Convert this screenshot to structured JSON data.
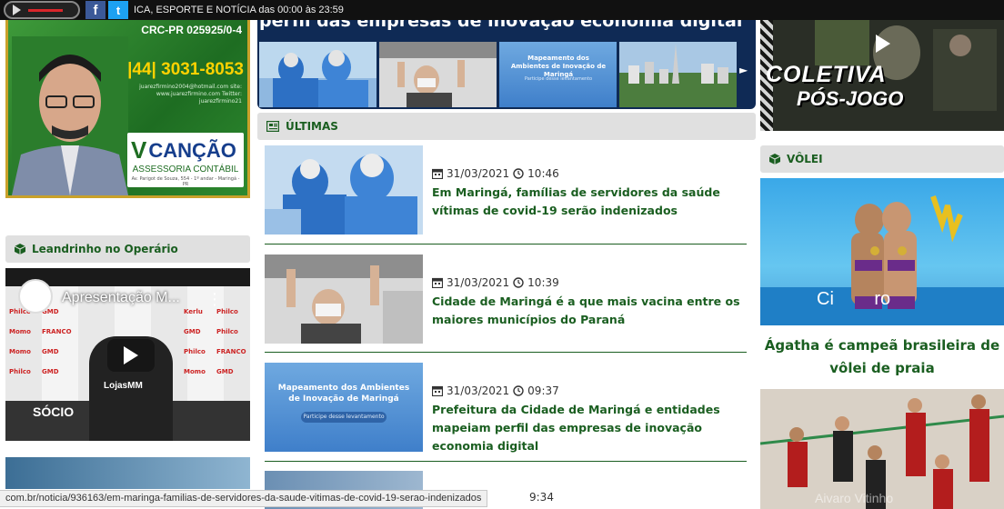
{
  "topbar": {
    "ticker": "ICA, ESPORTE E NOTÍCIA das 00:00 às 23:59",
    "fb": "f",
    "tw": "t"
  },
  "ad": {
    "crc": "CRC-PR 025925/0-4",
    "phone": "|44| 3031-8053",
    "small": "juarezfirmino2004@hotmail.com site: www.juarezfirmino.com Twitter: juarezfirmino21",
    "logo_v": "V",
    "logo_name": "CANÇÃO",
    "logo_sub": "ASSESSORIA CONTÁBIL",
    "logo_addr": "Av. Parigot de Souza, 554 - 1º andar - Maringá - PR"
  },
  "sections": {
    "ultimas": "ÚLTIMAS",
    "leandrinho": "Leandrinho no Operário",
    "volei": "VÔLEI"
  },
  "left_video": {
    "title": "Apresentação M...",
    "wall_brands": [
      "Philco",
      "GMD",
      "Kerlu",
      "Philco",
      "Momo",
      "FRANCO",
      "GMD",
      "Philco",
      "Momo",
      "GMD",
      "Philco",
      "FRANCO",
      "Philco",
      "GMD",
      "Momo",
      "GMD"
    ],
    "socio": "SÓCIO",
    "sponsor": "LojasMM"
  },
  "banner": {
    "headline": "perfil das empresas de inovação economia digital",
    "thumb3_title": "Mapeamento dos Ambientes de Inovação de Maringá",
    "thumb3_sub": "Participe desse levantamento"
  },
  "news": [
    {
      "date": "31/03/2021",
      "time": "10:46",
      "headline": "Em Maringá, famílias de servidores da saúde vítimas de covid-19 serão indenizados"
    },
    {
      "date": "31/03/2021",
      "time": "10:39",
      "headline": "Cidade de Maringá é a que mais vacina entre os maiores municípios do Paraná"
    },
    {
      "date": "31/03/2021",
      "time": "09:37",
      "headline": "Prefeitura da Cidade de Maringá e entidades mapeiam perfil das empresas de inovação economia digital"
    }
  ],
  "news3_img": {
    "title": "Mapeamento dos Ambientes de Inovação de Maringá",
    "sub": "Participe desse levantamento"
  },
  "right_video": {
    "line1": "COLETIVA",
    "line2": "PÓS-JOGO"
  },
  "volei": {
    "title": "Ágatha é campeã brasileira de vôlei de praia",
    "photo_text": "Ci        ro",
    "photo2_caption": "Aivaro Vitinho"
  },
  "statusbar": {
    "url": "com.br/noticia/936163/em-maringa-familias-de-servidores-da-saude-vitimas-de-covid-19-serao-indenizados",
    "partial_time": "9:34"
  },
  "colors": {
    "green": "#1a5e20",
    "gold": "#c9a12a",
    "dark_blue": "#0f2a55"
  }
}
